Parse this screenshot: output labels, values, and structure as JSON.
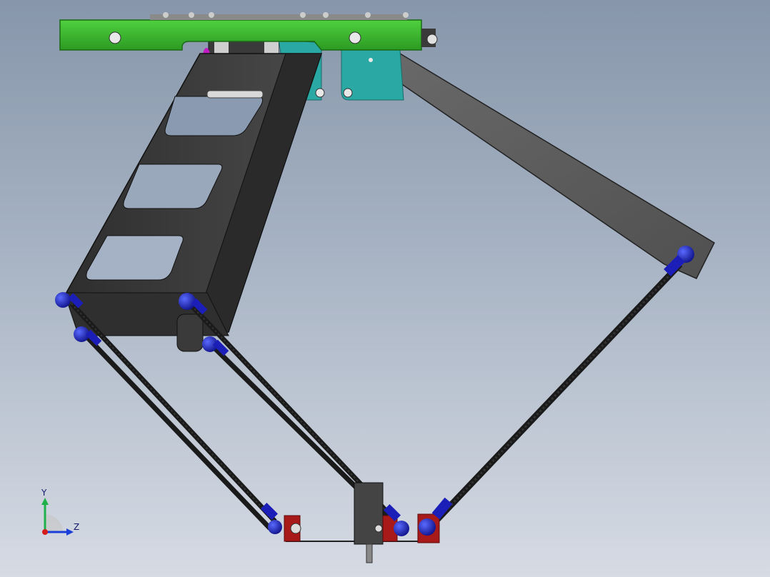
{
  "view": {
    "background_top": "#8796ab",
    "background_bottom": "#d6dbe4"
  },
  "triad": {
    "y_label": "Y",
    "z_label": "Z",
    "y_color": "#1fb04a",
    "z_color": "#1a3fd8",
    "x_color": "#d41c1c"
  },
  "colors": {
    "top_plate": "#35b52a",
    "frame_arm": "#3e3e3e",
    "upper_arm": "#5c5c5c",
    "motor_bracket": "#2aa8a4",
    "ball_joint": "#1b1fb8",
    "carbon_rod": "#1a1a1a",
    "effector_block": "#a81a1a",
    "motor": "#444444",
    "accent_magenta": "#c21ac2"
  }
}
